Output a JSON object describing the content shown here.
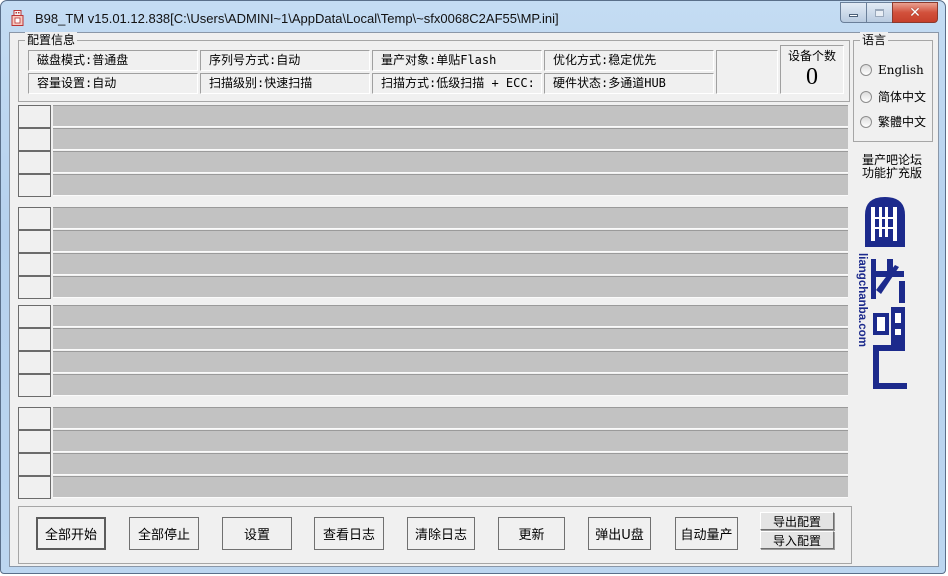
{
  "window": {
    "title": "B98_TM v15.01.12.838[C:\\Users\\ADMINI~1\\AppData\\Local\\Temp\\~sfx0068C2AF55\\MP.ini]",
    "minimize_icon": "minimize-icon",
    "maximize_icon": "maximize-icon",
    "close_icon": "close-icon",
    "close_glyph": "✕"
  },
  "config": {
    "legend": "配置信息",
    "cells": [
      "磁盘模式:普通盘",
      "序列号方式:自动",
      "量产对象:单贴Flash",
      "优化方式:稳定优先",
      "容量设置:自动",
      "扫描级别:快速扫描",
      "扫描方式:低级扫描 + ECC:",
      "硬件状态:多通道HUB"
    ],
    "device_count_label": "设备个数",
    "device_count": "0"
  },
  "language": {
    "legend": "语言",
    "options": [
      "English",
      "简体中文",
      "繁體中文"
    ],
    "selected": null
  },
  "forum": {
    "line1": "量产吧论坛",
    "line2": "功能扩充版"
  },
  "logo": {
    "text": "liangchanba.com",
    "color": "#1c2a8c"
  },
  "ports": {
    "groups": 4,
    "rows_per_group": 4
  },
  "buttons": {
    "start_all": "全部开始",
    "stop_all": "全部停止",
    "settings": "设置",
    "view_log": "查看日志",
    "clear_log": "清除日志",
    "update": "更新",
    "eject_udisk": "弹出U盘",
    "auto_mp": "自动量产",
    "export_config": "导出配置",
    "import_config": "导入配置"
  }
}
